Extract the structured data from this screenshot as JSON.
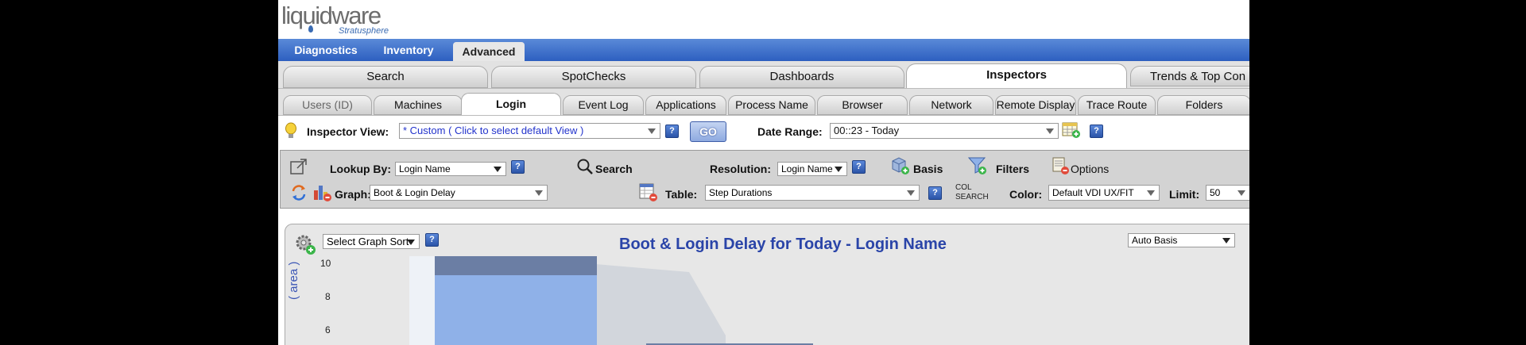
{
  "header": {
    "brand": "liquidware",
    "sub": "Stratusphere"
  },
  "topnav": [
    {
      "label": "Diagnostics",
      "active": false
    },
    {
      "label": "Inventory",
      "active": false
    },
    {
      "label": "Advanced",
      "active": true
    }
  ],
  "tabs_row1": [
    "Search",
    "SpotChecks",
    "Dashboards",
    "Inspectors",
    "Trends & Top Con"
  ],
  "tabs_row1_active": "Inspectors",
  "tabs_row2": [
    "Users (ID)",
    "Machines",
    "Login",
    "Event Log",
    "Applications",
    "Process Name",
    "Browser",
    "Network",
    "Remote Display",
    "Trace Route",
    "Folders"
  ],
  "tabs_row2_active": "Login",
  "inspector": {
    "view_label": "Inspector View:",
    "view_value": "* Custom ( Click to select default View )",
    "help": "?",
    "go": "GO",
    "date_label": "Date Range:",
    "date_value": "00::23 - Today"
  },
  "toolbar": {
    "lookup_label": "Lookup By:",
    "lookup_value": "Login Name",
    "search": "Search",
    "resolution_label": "Resolution:",
    "resolution_value": "Login Name",
    "basis": "Basis",
    "filters": "Filters",
    "options": "Options",
    "graph_label": "Graph:",
    "graph_value": "Boot & Login Delay",
    "table_label": "Table:",
    "table_value": "Step Durations",
    "col_search_1": "COL",
    "col_search_2": "SEARCH",
    "color_label": "Color:",
    "color_value": "Default VDI UX/FIT",
    "limit_label": "Limit:",
    "limit_value": "50"
  },
  "panel": {
    "sort_value": "Select Graph Sort",
    "basis_value": "Auto Basis"
  },
  "chart_data": {
    "type": "area",
    "title": "Boot & Login Delay for Today - Login Name",
    "ylabel": "( area )",
    "ylim_visible": [
      5,
      10
    ],
    "yticks": [
      10,
      8,
      6
    ],
    "series": [
      {
        "name": "",
        "color": "#6b7ea4",
        "values": [
          10,
          10,
          10
        ]
      },
      {
        "name": "",
        "color": "#8fb1e8",
        "values": [
          9,
          9,
          9
        ]
      }
    ],
    "colors": {
      "outline": "#bcc4d1",
      "bar_light": "#eef2f7"
    }
  }
}
